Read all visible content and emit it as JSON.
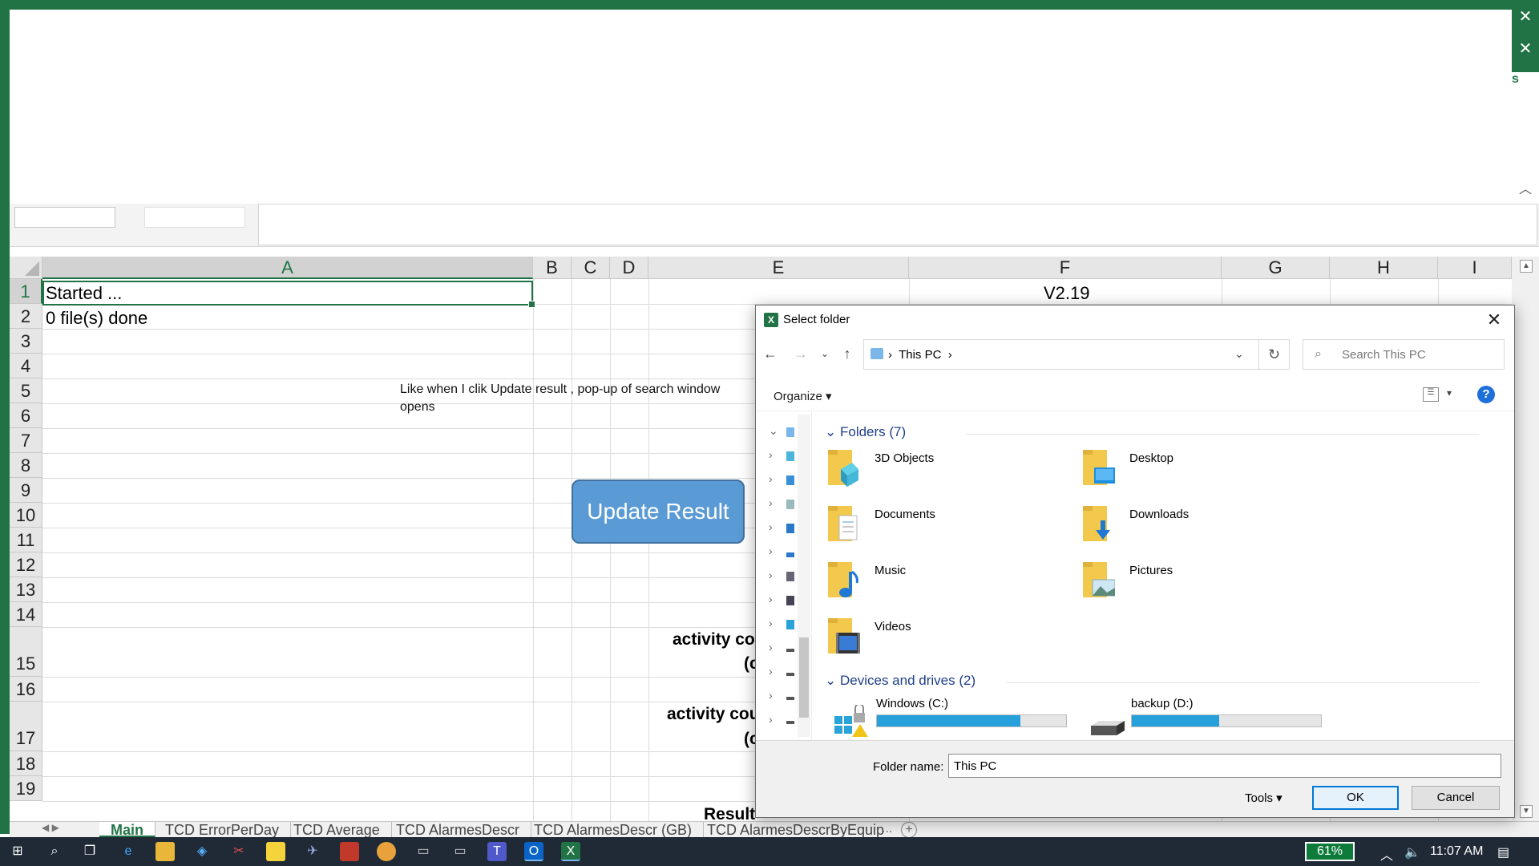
{
  "excel": {
    "columns": [
      "A",
      "B",
      "C",
      "D",
      "E",
      "F",
      "G",
      "H",
      "I"
    ],
    "rows": [
      "1",
      "2",
      "3",
      "4",
      "5",
      "6",
      "7",
      "8",
      "9",
      "10",
      "11",
      "12",
      "13",
      "14",
      "15",
      "16",
      "17",
      "18",
      "19"
    ],
    "cells": {
      "a1": "Started ...",
      "a2": "0 file(s) done",
      "f1": "V2.19",
      "e15": "activity cou",
      "e15b": "(c",
      "e17": "activity cou",
      "e17b": "(c",
      "result_partial": "Result"
    },
    "note": "Like when I clik Update result , pop-up of search window opens",
    "update_button": "Update Result",
    "ribbon_tab_fragment": "s",
    "sheets": [
      "Main",
      "TCD ErrorPerDay",
      "TCD Average",
      "TCD AlarmesDescr",
      "TCD AlarmesDescr (GB)",
      "TCD AlarmesDescrByEquip"
    ],
    "sheets_more": "...",
    "add_sheet": "+"
  },
  "dialog": {
    "title": "Select folder",
    "app_icon": "X",
    "address_location": "This PC",
    "search_placeholder": "Search This PC",
    "organize_label": "Organize ▾",
    "help_label": "?",
    "folders_header": "Folders (7)",
    "folders": [
      {
        "name": "3D Objects",
        "icon": "3d-objects-folder-icon"
      },
      {
        "name": "Desktop",
        "icon": "desktop-folder-icon"
      },
      {
        "name": "Documents",
        "icon": "documents-folder-icon"
      },
      {
        "name": "Downloads",
        "icon": "downloads-folder-icon"
      },
      {
        "name": "Music",
        "icon": "music-folder-icon"
      },
      {
        "name": "Pictures",
        "icon": "pictures-folder-icon"
      },
      {
        "name": "Videos",
        "icon": "videos-folder-icon"
      }
    ],
    "drives_header": "Devices and drives (2)",
    "drives": [
      {
        "name": "Windows (C:)",
        "used_fraction": 0.76
      },
      {
        "name": "backup (D:)",
        "used_fraction": 0.46
      }
    ],
    "folder_name_label": "Folder name:",
    "folder_name_value": "This PC",
    "tools_label": "Tools  ▾",
    "ok_label": "OK",
    "cancel_label": "Cancel"
  },
  "taskbar": {
    "battery": "61%",
    "time": "11:07 AM"
  },
  "colors": {
    "excel_green": "#217346",
    "button_blue": "#5b9bd5",
    "taskbar": "#1f2a36"
  }
}
